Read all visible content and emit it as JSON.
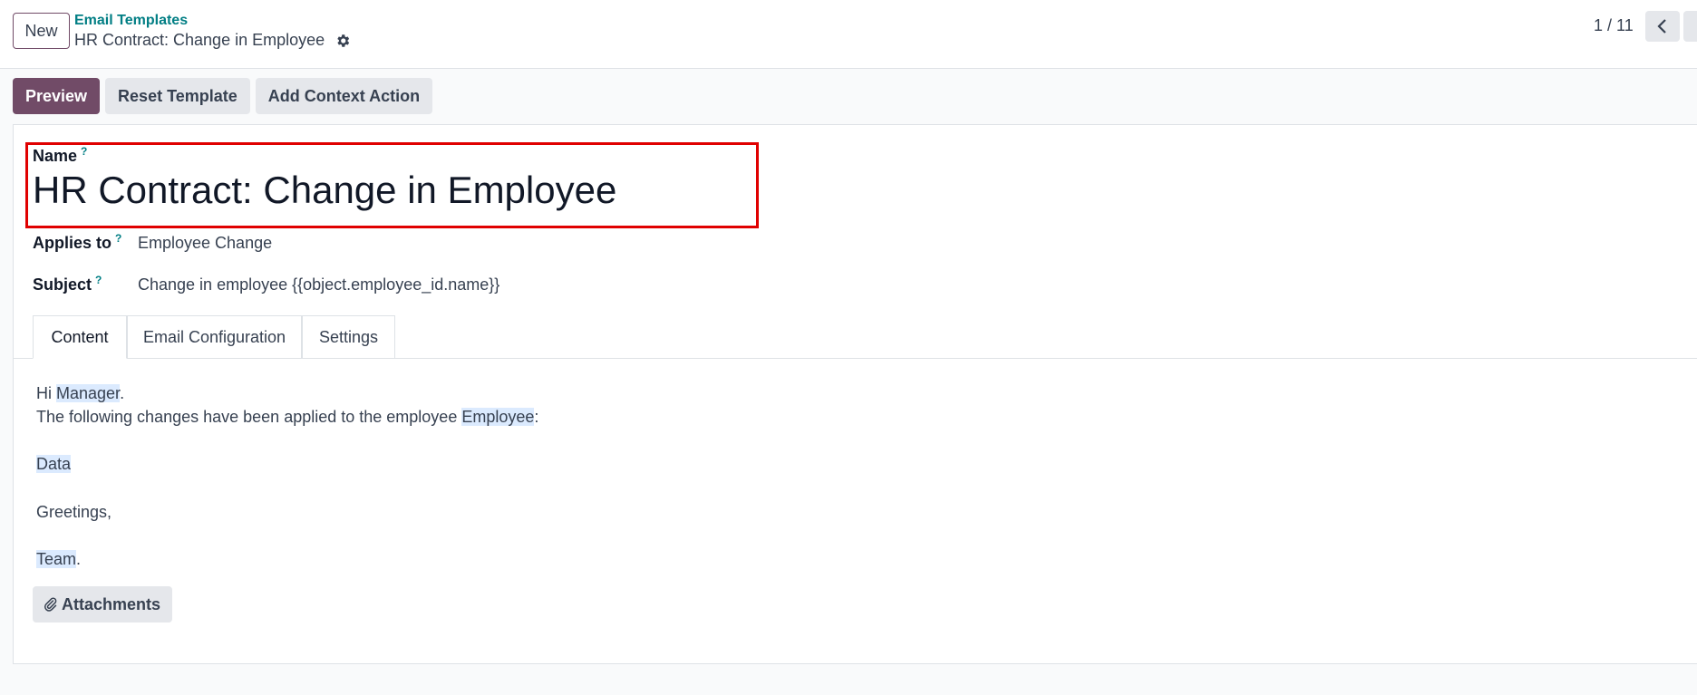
{
  "header": {
    "new_label": "New",
    "breadcrumb_parent": "Email Templates",
    "breadcrumb_current": "HR Contract: Change in Employee",
    "pager_value": "1 / 11"
  },
  "actions": {
    "preview": "Preview",
    "reset_template": "Reset Template",
    "add_context_action": "Add Context Action"
  },
  "form": {
    "name_label": "Name",
    "help_mark": "?",
    "name_value": "HR Contract: Change in Employee",
    "applies_to_label": "Applies to",
    "applies_to_value": "Employee Change",
    "subject_label": "Subject",
    "subject_value": "Change in employee {{object.employee_id.name}}"
  },
  "tabs": [
    {
      "label": "Content",
      "active": true
    },
    {
      "label": "Email Configuration",
      "active": false
    },
    {
      "label": "Settings",
      "active": false
    }
  ],
  "body": {
    "greeting_prefix": "Hi ",
    "manager": "Manager",
    "period": ".",
    "changes_text": "The following changes have been applied to the employee ",
    "employee": "Employee",
    "colon": ":",
    "data": "Data",
    "greetings": "Greetings,",
    "team": "Team",
    "team_period": "."
  },
  "attachments_label": "Attachments",
  "colors": {
    "primary": "#714b67",
    "link": "#017e84",
    "highlight_box": "#e00000",
    "placeholder_bg": "#dbeafe"
  }
}
